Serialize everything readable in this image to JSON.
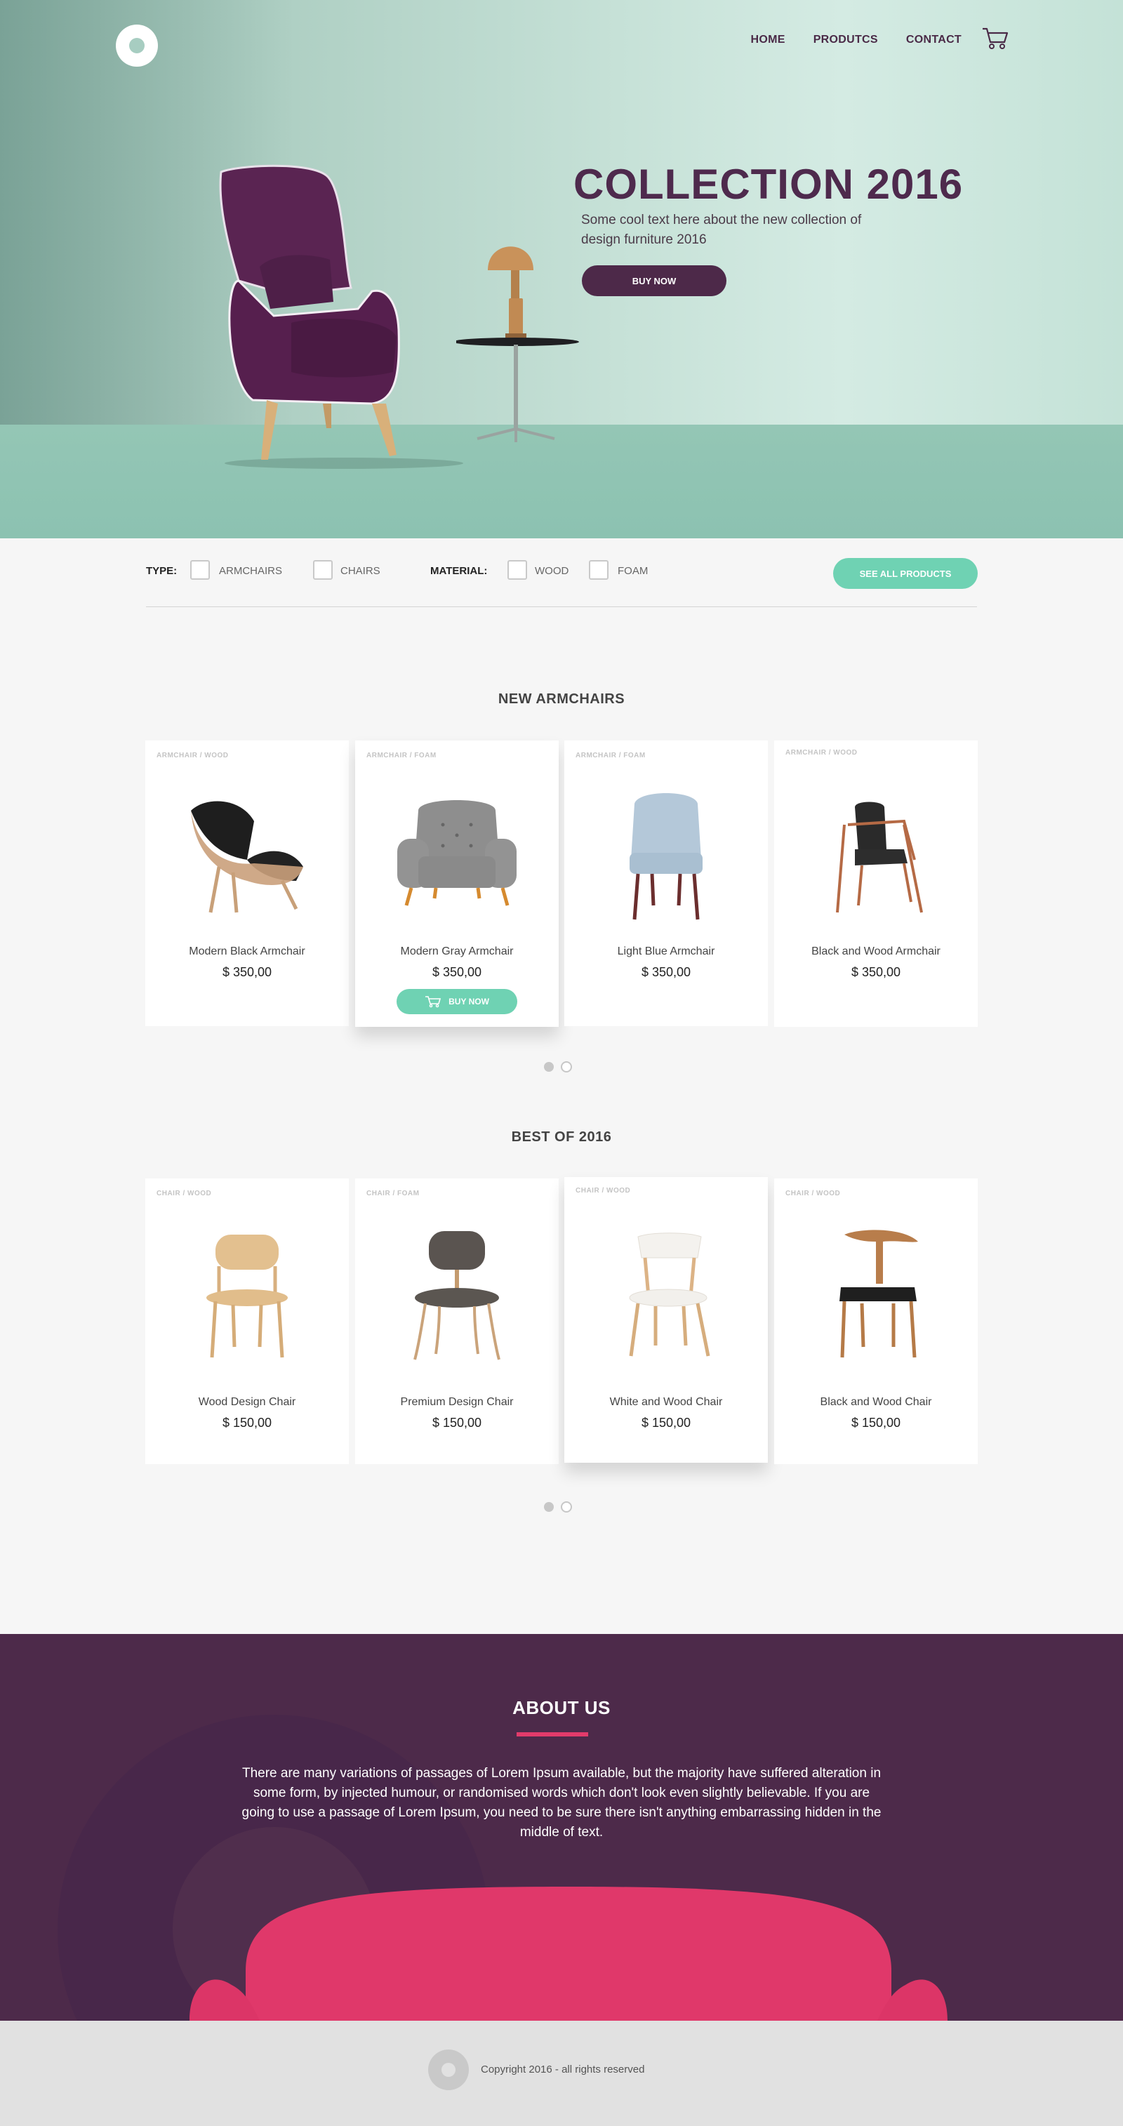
{
  "nav": {
    "items": [
      "HOME",
      "PRODUTCS",
      "CONTACT"
    ]
  },
  "hero": {
    "title": "COLLECTION 2016",
    "text": "Some cool text here about the new collection of design furniture 2016",
    "button": "BUY NOW"
  },
  "filter": {
    "type_label": "TYPE:",
    "type_options": [
      "ARMCHAIRS",
      "CHAIRS"
    ],
    "material_label": "MATERIAL:",
    "material_options": [
      "WOOD",
      "FOAM"
    ],
    "see_all": "SEE ALL PRODUCTS"
  },
  "armchairs": {
    "title": "NEW ARMCHAIRS",
    "items": [
      {
        "tag": "ARMCHAIR  /  WOOD",
        "name": "Modern Black Armchair",
        "price": "$ 350,00"
      },
      {
        "tag": "ARMCHAIR  /  FOAM",
        "name": "Modern Gray Armchair",
        "price": "$ 350,00",
        "buy": "BUY NOW"
      },
      {
        "tag": "ARMCHAIR  /  FOAM",
        "name": "Light Blue Armchair",
        "price": "$ 350,00"
      },
      {
        "tag": "ARMCHAIR  /  WOOD",
        "name": "Black and Wood Armchair",
        "price": "$ 350,00"
      }
    ]
  },
  "best": {
    "title": "BEST OF 2016",
    "items": [
      {
        "tag": "CHAIR  /  WOOD",
        "name": "Wood Design Chair",
        "price": "$ 150,00"
      },
      {
        "tag": "CHAIR  /  FOAM",
        "name": "Premium Design Chair",
        "price": "$ 150,00"
      },
      {
        "tag": "CHAIR  /  WOOD",
        "name": "White and Wood Chair",
        "price": "$ 150,00"
      },
      {
        "tag": "CHAIR  /  WOOD",
        "name": "Black and Wood Chair",
        "price": "$ 150,00"
      }
    ]
  },
  "about": {
    "title": "ABOUT US",
    "text": "There are many variations of passages of Lorem Ipsum available, but the majority have suffered alteration in some form, by injected humour, or randomised words which don't look even slightly believable. If you are going to use a passage of Lorem Ipsum, you need to be sure there isn't anything embarrassing hidden in the middle of text."
  },
  "footer": {
    "text": "Copyright 2016 - all rights reserved"
  },
  "colors": {
    "brand_purple": "#4d2949",
    "accent_mint": "#6fd2b3",
    "accent_pink": "#e23b6b"
  }
}
